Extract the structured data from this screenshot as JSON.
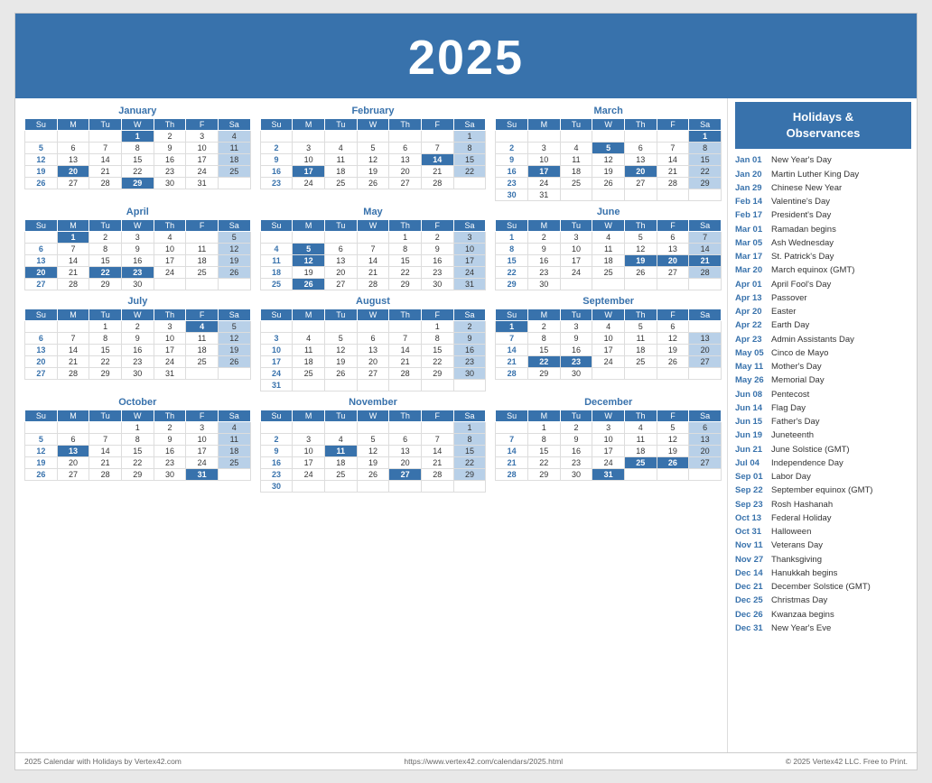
{
  "header": {
    "year": "2025"
  },
  "sidebar": {
    "title": "Holidays &\nObservances",
    "holidays": [
      {
        "date": "Jan 01",
        "name": "New Year's Day"
      },
      {
        "date": "Jan 20",
        "name": "Martin Luther King Day"
      },
      {
        "date": "Jan 29",
        "name": "Chinese New Year"
      },
      {
        "date": "Feb 14",
        "name": "Valentine's Day"
      },
      {
        "date": "Feb 17",
        "name": "President's Day"
      },
      {
        "date": "Mar 01",
        "name": "Ramadan begins"
      },
      {
        "date": "Mar 05",
        "name": "Ash Wednesday"
      },
      {
        "date": "Mar 17",
        "name": "St. Patrick's Day"
      },
      {
        "date": "Mar 20",
        "name": "March equinox (GMT)"
      },
      {
        "date": "Apr 01",
        "name": "April Fool's Day"
      },
      {
        "date": "Apr 13",
        "name": "Passover"
      },
      {
        "date": "Apr 20",
        "name": "Easter"
      },
      {
        "date": "Apr 22",
        "name": "Earth Day"
      },
      {
        "date": "Apr 23",
        "name": "Admin Assistants Day"
      },
      {
        "date": "May 05",
        "name": "Cinco de Mayo"
      },
      {
        "date": "May 11",
        "name": "Mother's Day"
      },
      {
        "date": "May 26",
        "name": "Memorial Day"
      },
      {
        "date": "Jun 08",
        "name": "Pentecost"
      },
      {
        "date": "Jun 14",
        "name": "Flag Day"
      },
      {
        "date": "Jun 15",
        "name": "Father's Day"
      },
      {
        "date": "Jun 19",
        "name": "Juneteenth"
      },
      {
        "date": "Jun 21",
        "name": "June Solstice (GMT)"
      },
      {
        "date": "Jul 04",
        "name": "Independence Day"
      },
      {
        "date": "Sep 01",
        "name": "Labor Day"
      },
      {
        "date": "Sep 22",
        "name": "September equinox (GMT)"
      },
      {
        "date": "Sep 23",
        "name": "Rosh Hashanah"
      },
      {
        "date": "Oct 13",
        "name": "Federal Holiday"
      },
      {
        "date": "Oct 31",
        "name": "Halloween"
      },
      {
        "date": "Nov 11",
        "name": "Veterans Day"
      },
      {
        "date": "Nov 27",
        "name": "Thanksgiving"
      },
      {
        "date": "Dec 14",
        "name": "Hanukkah begins"
      },
      {
        "date": "Dec 21",
        "name": "December Solstice (GMT)"
      },
      {
        "date": "Dec 25",
        "name": "Christmas Day"
      },
      {
        "date": "Dec 26",
        "name": "Kwanzaa begins"
      },
      {
        "date": "Dec 31",
        "name": "New Year's Eve"
      }
    ]
  },
  "footer": {
    "left": "2025 Calendar with Holidays by Vertex42.com",
    "center": "https://www.vertex42.com/calendars/2025.html",
    "right": "© 2025 Vertex42 LLC. Free to Print."
  }
}
